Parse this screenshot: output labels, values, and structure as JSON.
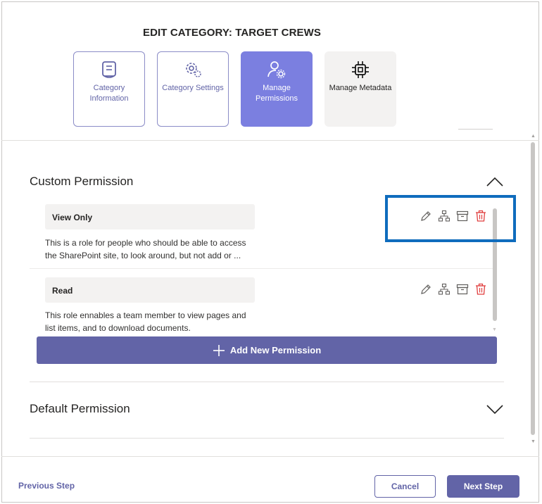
{
  "dialog": {
    "title": "EDIT CATEGORY: TARGET CREWS"
  },
  "steps": [
    {
      "label": "Category Information",
      "icon": "form-icon",
      "state": "done"
    },
    {
      "label": "Category Settings",
      "icon": "gear-icon",
      "state": "done"
    },
    {
      "label": "Manage Permissions",
      "icon": "person-gear-icon",
      "state": "active"
    },
    {
      "label": "Manage Metadata",
      "icon": "chip-icon",
      "state": "pending"
    }
  ],
  "custom_section": {
    "title": "Custom Permission",
    "expanded": true,
    "permissions": [
      {
        "name": "View Only",
        "description": "This is a role for people who should be able to access the SharePoint site, to look around, but not add or ..."
      },
      {
        "name": "Read",
        "description": "This role ennables a team member to view pages and list items, and to download documents."
      }
    ],
    "row_actions": [
      "edit-icon",
      "hierarchy-icon",
      "archive-icon",
      "delete-icon"
    ],
    "add_button_label": "Add New Permission"
  },
  "default_section": {
    "title": "Default Permission",
    "expanded": false
  },
  "footer": {
    "previous_label": "Previous Step",
    "cancel_label": "Cancel",
    "next_label": "Next Step"
  },
  "colors": {
    "accent": "#6264a7",
    "active_step": "#7b7fe0",
    "delete": "#e03e3e",
    "highlight": "#0f6cbd"
  }
}
